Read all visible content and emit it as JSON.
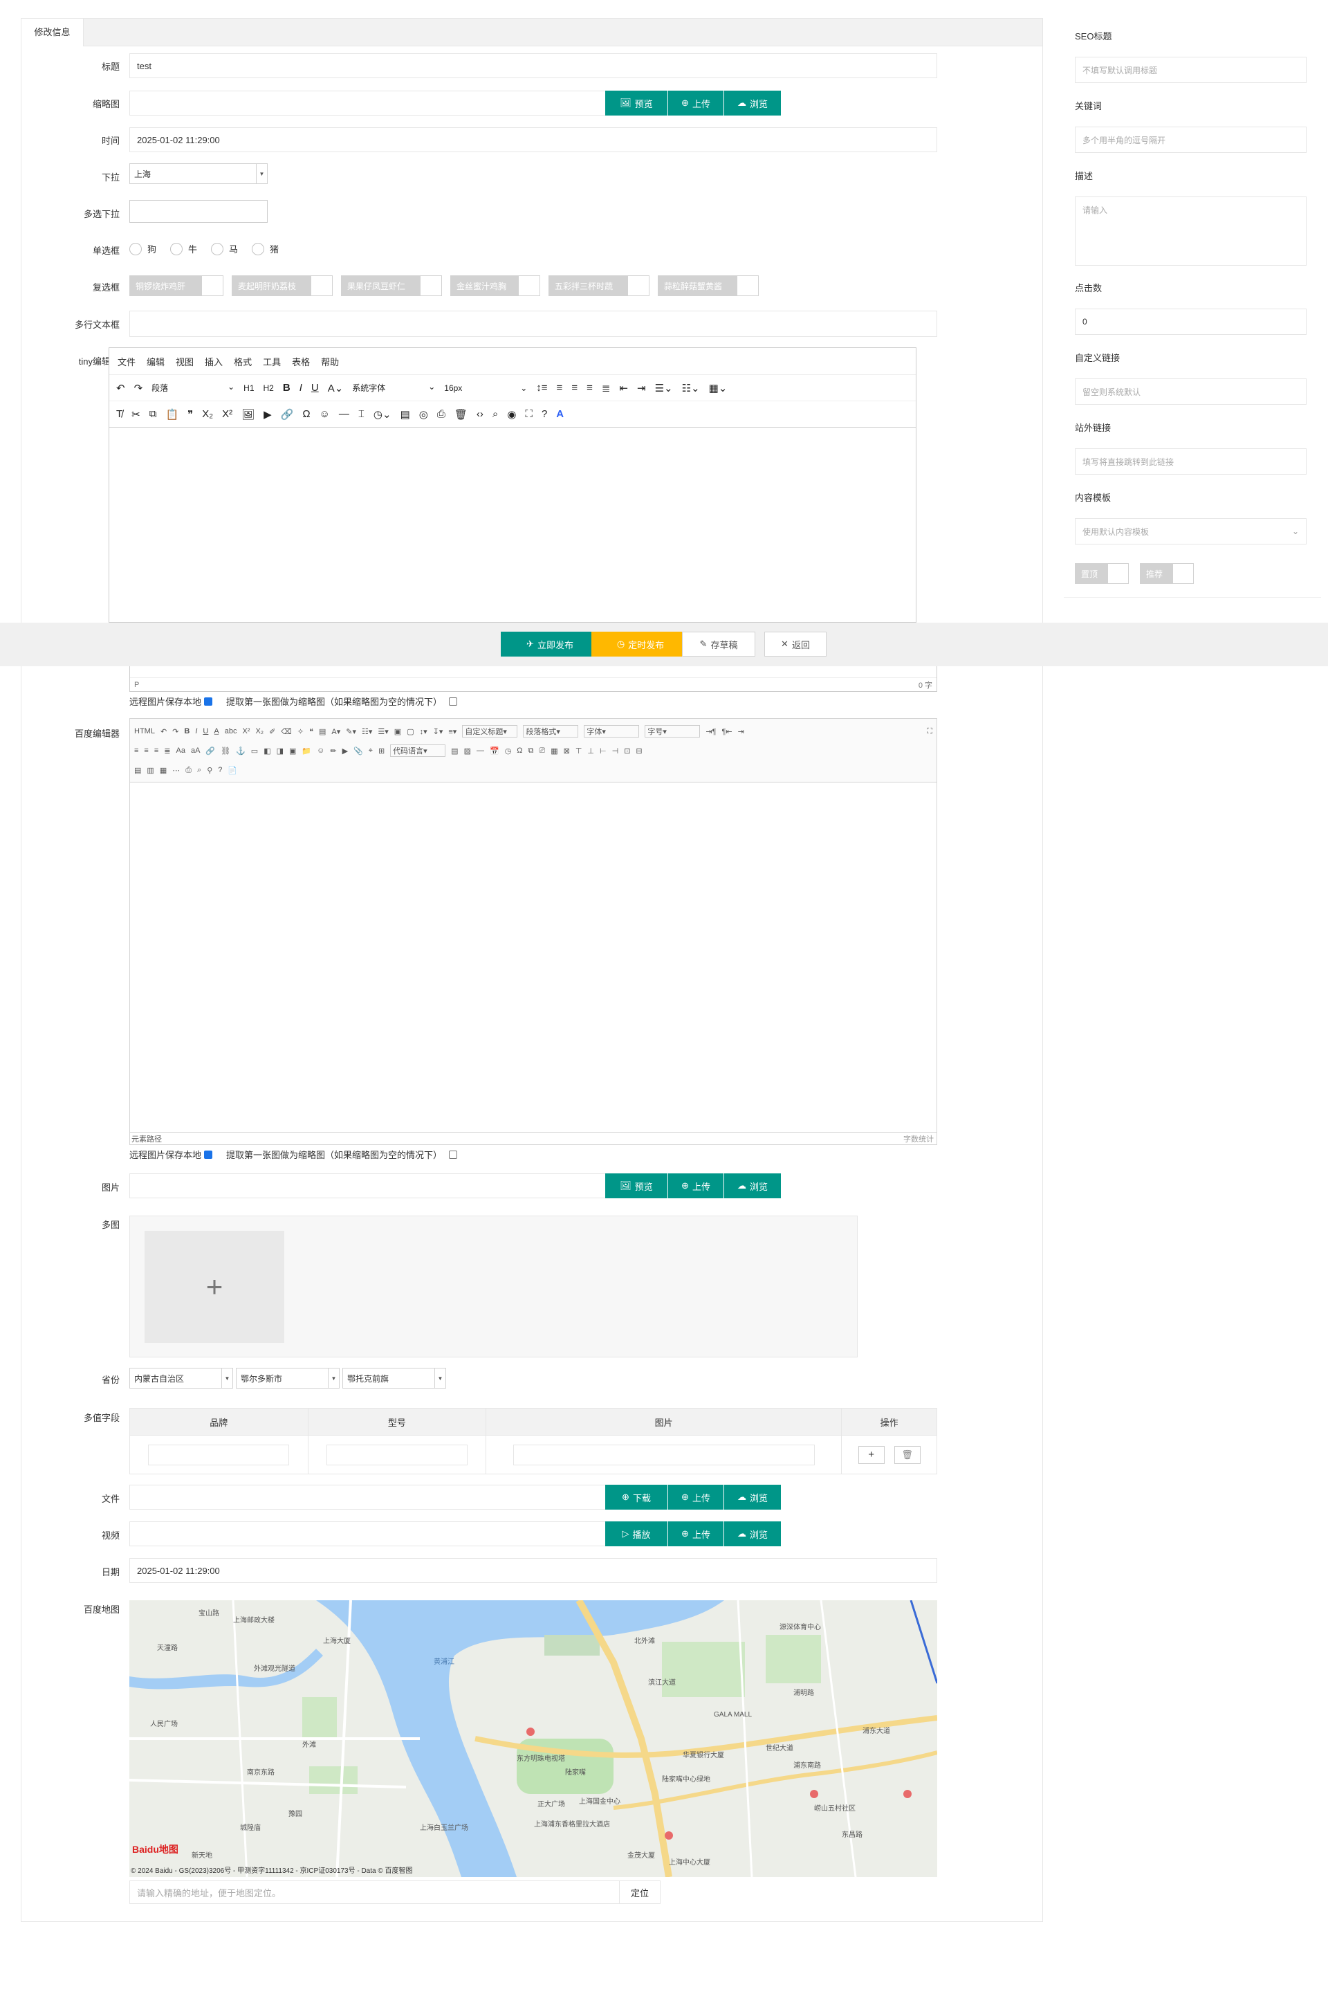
{
  "tab": {
    "label": "修改信息"
  },
  "form": {
    "title": {
      "label": "标题",
      "value": "test"
    },
    "thumb": {
      "label": "缩略图",
      "value": "",
      "buttons": [
        "预览",
        "上传",
        "浏览"
      ]
    },
    "time": {
      "label": "时间",
      "value": "2025-01-02 11:29:00"
    },
    "dropdown": {
      "label": "下拉",
      "value": "上海"
    },
    "multi_select": {
      "label": "多选下拉",
      "value": ""
    },
    "radio": {
      "label": "单选框",
      "options": [
        "狗",
        "牛",
        "马",
        "猪"
      ]
    },
    "checkbox": {
      "label": "复选框",
      "options": [
        "铜锣烧炸鸡肝",
        "麦起明肝奶荔枝",
        "果果仔凤豆虾仁",
        "金丝蜜汁鸡胸",
        "五彩拌三杯时蔬",
        "蒜粒醉菇蟹黄酱"
      ]
    },
    "textarea": {
      "label": "多行文本框",
      "value": ""
    },
    "tiny": {
      "label": "tiny编辑器",
      "menu": [
        "文件",
        "编辑",
        "视图",
        "插入",
        "格式",
        "工具",
        "表格",
        "帮助"
      ],
      "paragraph": "段落",
      "h1": "H1",
      "h2": "H2",
      "font": "系统字体",
      "size": "16px",
      "status_path": "P",
      "word_count": "0 字",
      "remote_save": "远程图片保存本地",
      "first_thumb": "提取第一张图做为缩略图（如果缩略图为空的情况下）"
    },
    "baidu": {
      "label": "百度编辑器",
      "custom_title": "自定义标题",
      "para_format": "段落格式",
      "font": "字体",
      "size": "字号",
      "code_lang": "代码语言",
      "element_path": "元素路径",
      "word_count": "字数统计",
      "remote_save": "远程图片保存本地",
      "first_thumb": "提取第一张图做为缩略图（如果缩略图为空的情况下）"
    },
    "image": {
      "label": "图片",
      "value": "",
      "buttons": [
        "预览",
        "上传",
        "浏览"
      ]
    },
    "multi_image": {
      "label": "多图",
      "add": "+"
    },
    "province": {
      "label": "省份",
      "values": [
        "内蒙古自治区",
        "鄂尔多斯市",
        "鄂托克前旗"
      ]
    },
    "multi_field": {
      "label": "多值字段",
      "columns": [
        "品牌",
        "型号",
        "图片",
        "操作"
      ]
    },
    "file": {
      "label": "文件",
      "value": "",
      "buttons": [
        "下载",
        "上传",
        "浏览"
      ]
    },
    "video": {
      "label": "视频",
      "value": "",
      "buttons": [
        "播放",
        "上传",
        "浏览"
      ]
    },
    "date": {
      "label": "日期",
      "value": "2025-01-02 11:29:00"
    },
    "map": {
      "label": "百度地图",
      "copyright": "© 2024 Baidu - GS(2023)3206号 - 甲测资字11111342 - 京ICP证030173号 - Data © 百度智图",
      "logo": "Baidu地图",
      "places": [
        "上海邮政大楼",
        "天潼路",
        "上海大厦",
        "外滩观光隧道",
        "南京东路",
        "东方明珠电视塔",
        "陆家嘴",
        "上海国金中心",
        "正大广场",
        "上海浦东香格里拉大酒店",
        "华夏银行大厦",
        "陆家嘴中心绿地",
        "金茂大厦",
        "上海中心大厦",
        "世纪大道",
        "浦东南路",
        "浦东大道",
        "东昌路",
        "GALA MALL",
        "滨江大道",
        "黄浦江",
        "宝山路",
        "外滩",
        "人民广场",
        "城隍庙",
        "豫园",
        "新天地",
        "源深体育中心",
        "上海白玉兰广场",
        "北外滩",
        "浦明路",
        "崂山五村社区"
      ],
      "search_placeholder": "请输入精确的地址，便于地图定位。",
      "locate": "定位"
    }
  },
  "actions": {
    "publish": "立即发布",
    "schedule": "定时发布",
    "draft": "存草稿",
    "back": "返回"
  },
  "side": {
    "seo_title": {
      "label": "SEO标题",
      "placeholder": "不填写默认调用标题"
    },
    "keywords": {
      "label": "关键词",
      "placeholder": "多个用半角的逗号隔开"
    },
    "description": {
      "label": "描述",
      "placeholder": "请输入"
    },
    "clicks": {
      "label": "点击数",
      "value": "0"
    },
    "custom_link": {
      "label": "自定义链接",
      "placeholder": "留空则系统默认"
    },
    "external_link": {
      "label": "站外链接",
      "placeholder": "填写将直接跳转到此链接"
    },
    "template": {
      "label": "内容模板",
      "placeholder": "使用默认内容模板"
    },
    "switches": [
      "置顶",
      "推荐"
    ]
  },
  "colors": {
    "teal": "#009688",
    "orange": "#ffb800",
    "water": "#a3cdf5"
  }
}
